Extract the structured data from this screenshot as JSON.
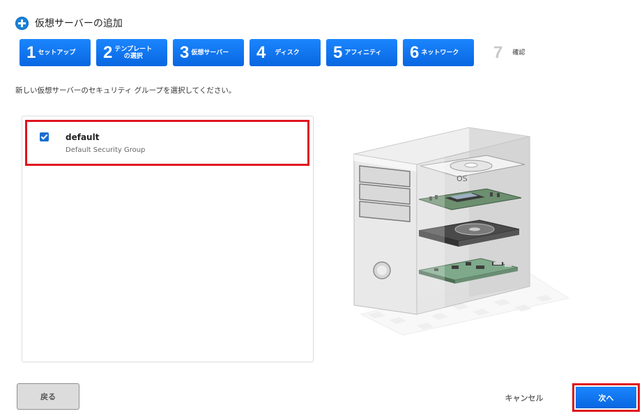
{
  "header": {
    "title": "仮想サーバーの追加"
  },
  "steps": [
    {
      "num": "1",
      "label": "セットアップ"
    },
    {
      "num": "2",
      "label_line1": "テンプレート",
      "label_line2": "の選択"
    },
    {
      "num": "3",
      "label": "仮想サーバー"
    },
    {
      "num": "4",
      "label": "ディスク"
    },
    {
      "num": "5",
      "label": "アフィニティ"
    },
    {
      "num": "6",
      "label": "ネットワーク"
    },
    {
      "num": "7",
      "label": "確認"
    }
  ],
  "instruction": "新しい仮想サーバーのセキュリティ グループを選択してください。",
  "security_groups": [
    {
      "name": "default",
      "description": "Default Security Group",
      "checked": true
    }
  ],
  "illustration": {
    "os_label": "OS"
  },
  "footer": {
    "back_label": "戻る",
    "cancel_label": "キャンセル",
    "next_label": "次へ"
  },
  "colors": {
    "accent": "#0a73f0",
    "highlight": "#e0141e"
  }
}
